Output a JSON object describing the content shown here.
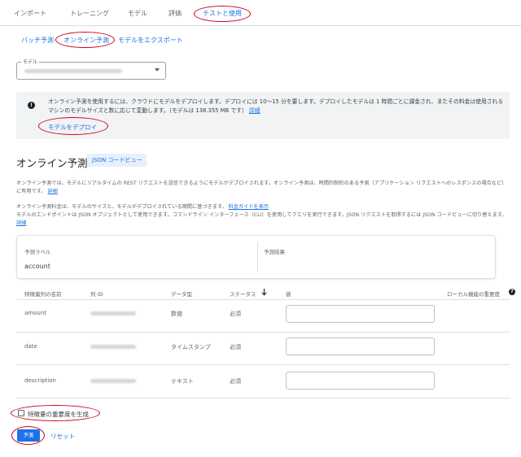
{
  "tabs": [
    {
      "label": "インポート"
    },
    {
      "label": "トレーニング"
    },
    {
      "label": "モデル"
    },
    {
      "label": "評価"
    },
    {
      "label": "テストと使用"
    }
  ],
  "subnav": {
    "batch": "バッチ予測",
    "online": "オンライン予測",
    "export": "モデルをエクスポート"
  },
  "model_select": {
    "label": "モデル"
  },
  "banner": {
    "text": "オンライン予測を使用するには、クラウドにモデルをデプロイします。デプロイには 10～15 分を要します。デプロイしたモデルは 1 時間ごとに課金され、またその料金は使用されるマシンのモデルサイズと数に応じて変動します。（モデルは 138.355 MB です）",
    "details_link": "詳細",
    "deploy_button": "モデルをデプロイ"
  },
  "section": {
    "title": "オンライン予測",
    "json_button": "JSON コードビュー",
    "para1": "オンライン予測では、モデルにリアルタイムの REST リクエストを送信できるようにモデルがデプロイされます。オンライン予測は、時間的制約のある予測（アプリケーション リクエストへのレスポンスの場合など）に有用です。",
    "para1_link": "詳細",
    "para2a": "オンライン予測料金は、モデルのサイズと、モデルがデプロイされている期間に基づきます。",
    "para2a_link": "料金ガイドを表示",
    "para2b": "モデルのエンドポイントは JSON オブジェクトとして使用できます。コマンドライン インターフェース（CLI）を使用してクエリを実行できます。JSON リクエストを取得するには JSON コードビューに切り替えます。",
    "para2b_link": "詳細"
  },
  "result_card": {
    "label_header": "予測ラベル",
    "label_value": "account",
    "result_header": "予測結果"
  },
  "features_table": {
    "headers": {
      "feature": "特徴量列の名前",
      "column_id": "列 ID",
      "data_type": "データ型",
      "status": "ステータス",
      "value": "値",
      "importance": "ローカル機能の重要度"
    },
    "sort_icon": "arrow-down-icon",
    "rows": [
      {
        "name": "amount",
        "type": "数値",
        "status": "必須"
      },
      {
        "name": "date",
        "type": "タイムスタンプ",
        "status": "必須"
      },
      {
        "name": "description",
        "type": "テキスト",
        "status": "必須"
      }
    ]
  },
  "footer": {
    "checkbox_label": "特徴量の重要度を生成",
    "predict_button": "予測",
    "reset_button": "リセット"
  },
  "colors": {
    "accent": "#1a73e8",
    "annotation": "#d0021b",
    "banner_bg": "#f1f3f4"
  }
}
